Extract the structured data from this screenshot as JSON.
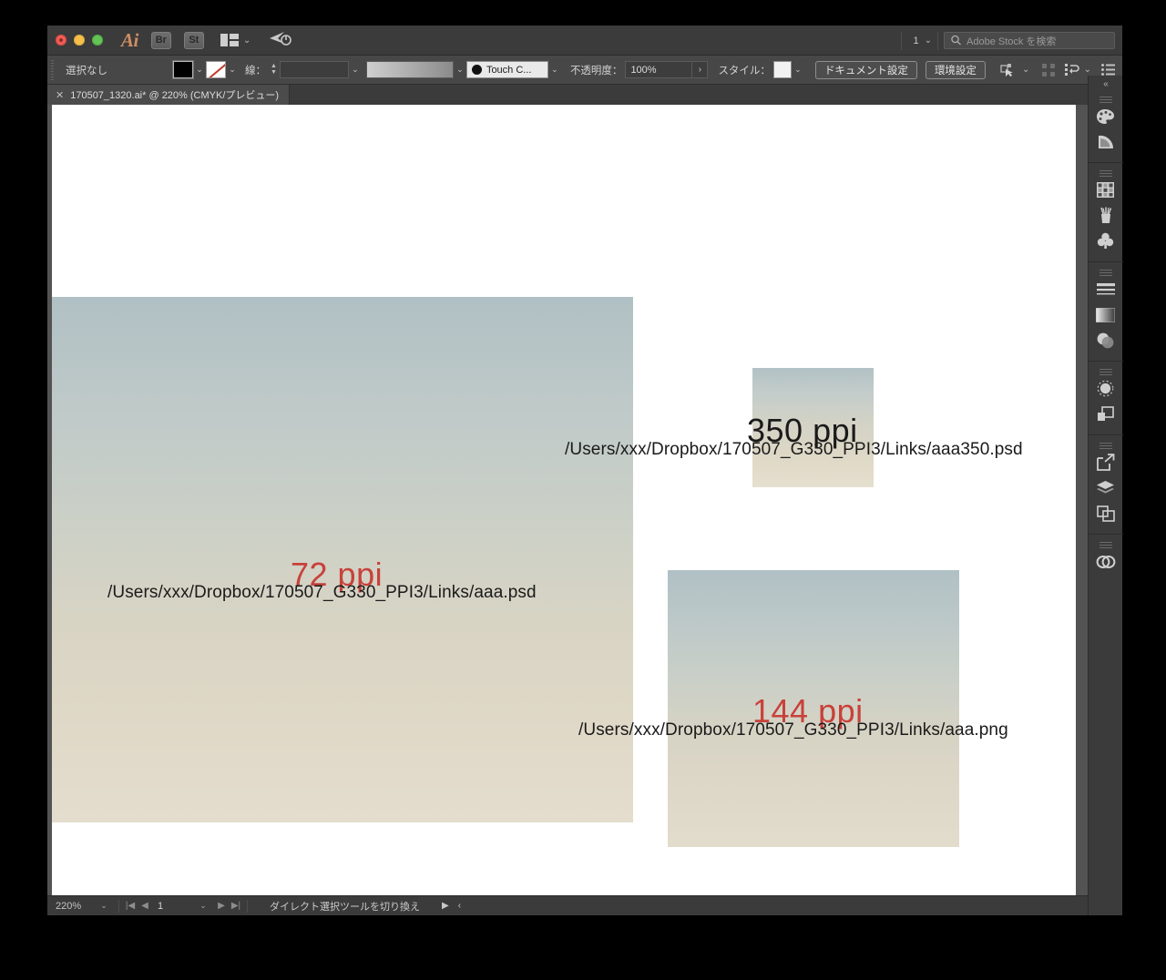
{
  "app": {
    "name": "Adobe Illustrator",
    "logo_text": "Ai",
    "bridge_label": "Br",
    "stock_label": "St",
    "workspace_number": "1",
    "search_placeholder": "Adobe Stock を検索"
  },
  "controlbar": {
    "selection_status": "選択なし",
    "stroke_label": "線：",
    "stroke_weight": "",
    "brush_definition": "Touch C...",
    "opacity_label": "不透明度：",
    "opacity_value": "100%",
    "style_label": "スタイル：",
    "document_setup_button": "ドキュメント設定",
    "preferences_button": "環境設定"
  },
  "tabbar": {
    "document_tab": "170507_1320.ai* @ 220% (CMYK/プレビュー)",
    "close_glyph": "✕"
  },
  "canvas": {
    "images": [
      {
        "id": "psd-72",
        "ppi_label": "72 ppi",
        "ppi_color": "#c8413a",
        "path": "/Users/xxx/Dropbox/170507_G330_PPI3/Links/aaa.psd"
      },
      {
        "id": "psd-350",
        "ppi_label": "350 ppi",
        "ppi_color": "#1a1a1a",
        "path": "/Users/xxx/Dropbox/170507_G330_PPI3/Links/aaa350.psd"
      },
      {
        "id": "png-144",
        "ppi_label": "144 ppi",
        "ppi_color": "#c8413a",
        "path": "/Users/xxx/Dropbox/170507_G330_PPI3/Links/aaa.png"
      }
    ]
  },
  "statusbar": {
    "zoom": "220%",
    "page": "1",
    "tool_status": "ダイレクト選択ツールを切り換え"
  },
  "dock": {
    "collapse_glyph": "«",
    "items": [
      {
        "name": "color-panel",
        "icon": "palette-icon"
      },
      {
        "name": "color-guide-panel",
        "icon": "color-guide-icon"
      },
      {
        "name": "swatches-panel",
        "icon": "swatches-icon"
      },
      {
        "name": "brushes-panel",
        "icon": "brushes-icon"
      },
      {
        "name": "symbols-panel",
        "icon": "symbols-icon"
      },
      {
        "name": "stroke-panel",
        "icon": "stroke-lines-icon"
      },
      {
        "name": "gradient-panel",
        "icon": "gradient-icon"
      },
      {
        "name": "transparency-panel",
        "icon": "transparency-icon"
      },
      {
        "name": "appearance-panel",
        "icon": "appearance-icon"
      },
      {
        "name": "pathfinder-panel",
        "icon": "pathfinder-icon"
      },
      {
        "name": "asset-export-panel",
        "icon": "export-icon"
      },
      {
        "name": "layers-panel",
        "icon": "layers-icon"
      },
      {
        "name": "artboards-panel",
        "icon": "artboards-icon"
      },
      {
        "name": "links-panel",
        "icon": "links-chain-icon"
      }
    ]
  }
}
